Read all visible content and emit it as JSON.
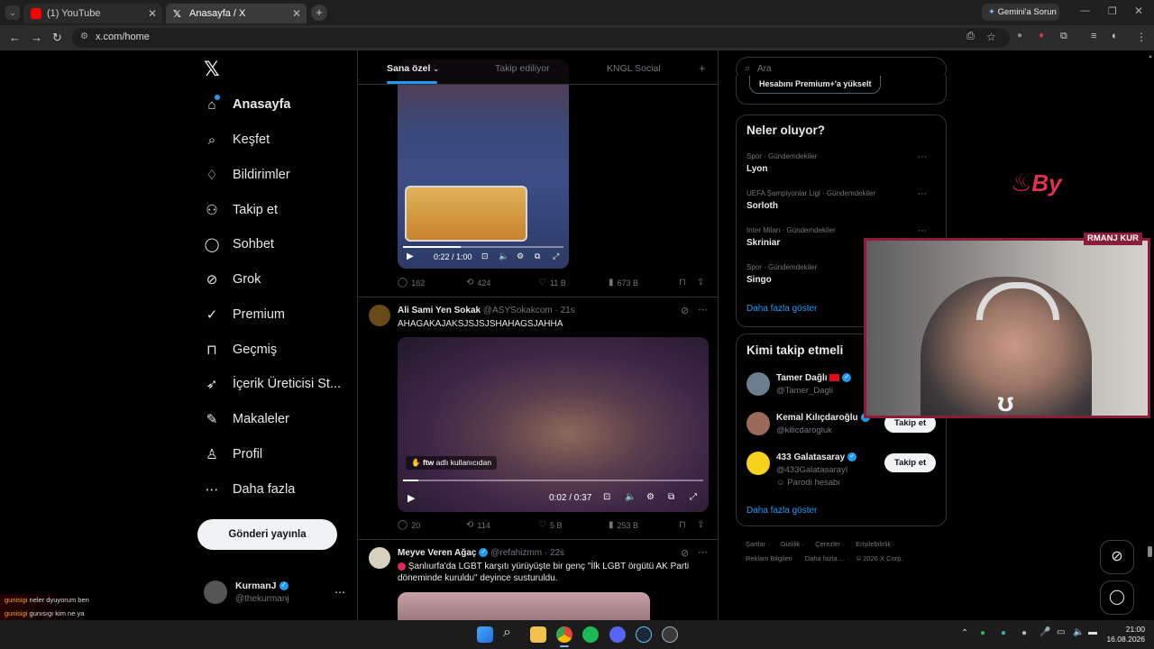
{
  "browser": {
    "tabs": [
      {
        "title": "(1) YouTube"
      },
      {
        "title": "Anasayfa / X"
      }
    ],
    "url": "x.com/home",
    "gemini_label": "Gemini'a Sorun"
  },
  "nav": {
    "items": [
      {
        "label": "Anasayfa",
        "icon": "home-icon"
      },
      {
        "label": "Keşfet",
        "icon": "search-icon"
      },
      {
        "label": "Bildirimler",
        "icon": "bell-icon"
      },
      {
        "label": "Takip et",
        "icon": "add-person-icon"
      },
      {
        "label": "Sohbet",
        "icon": "chat-icon"
      },
      {
        "label": "Grok",
        "icon": "grok-icon"
      },
      {
        "label": "Premium",
        "icon": "premium-icon"
      },
      {
        "label": "Geçmiş",
        "icon": "bookmark-icon"
      },
      {
        "label": "İçerik Üreticisi St...",
        "icon": "rocket-icon"
      },
      {
        "label": "Makaleler",
        "icon": "article-icon"
      },
      {
        "label": "Profil",
        "icon": "person-icon"
      },
      {
        "label": "Daha fazla",
        "icon": "more-circle-icon"
      }
    ],
    "post_button": "Gönderi yayınla",
    "profile": {
      "name": "KurmanJ",
      "handle": "@thekurmanj"
    }
  },
  "feed": {
    "tabs": [
      "Sana özel",
      "Takip ediliyor",
      "KNGL Social"
    ],
    "tweet1": {
      "video_time": "0:22 / 1:00",
      "replies": "162",
      "retweets": "424",
      "likes": "11 B",
      "views": "673 B"
    },
    "tweet2": {
      "name": "Ali Sami Yen Sokak",
      "handle": "@ASYSokakcom",
      "time": "· 21s",
      "text": "AHAGAKAJAKSJSJSJSHAHAGSJAHHA",
      "video_caption_user": "ftw",
      "video_caption_rest": "adlı kullanıcıdan",
      "video_time": "0:02 / 0:37",
      "replies": "20",
      "retweets": "114",
      "likes": "5 B",
      "views": "253 B"
    },
    "tweet3": {
      "name": "Meyve Veren Ağaç",
      "handle": "@refahizmm",
      "time": "· 22s",
      "text": "Şanlıurfa'da LGBT karşıtı yürüyüşte bir genç \"İlk LGBT örgütü AK Parti döneminde kuruldu\" deyince susturuldu."
    }
  },
  "right": {
    "search_placeholder": "Ara",
    "premium_btn": "Hesabını Premium+'a yükselt",
    "trends_title": "Neler oluyor?",
    "trends": [
      {
        "meta": "Spor · Gündemdekiler",
        "name": "Lyon"
      },
      {
        "meta": "UEFA Şampiyonlar Ligi · Gündemdekiler",
        "name": "Sorloth"
      },
      {
        "meta": "Inter Milan · Gündemdekiler",
        "name": "Skriniar"
      },
      {
        "meta": "Spor · Gündemdekiler",
        "name": "Singo"
      }
    ],
    "show_more": "Daha fazla göster",
    "who_title": "Kimi takip etmeli",
    "who": [
      {
        "name": "Tamer Dağlı",
        "handle": "@Tamer_Dagli"
      },
      {
        "name": "Kemal Kılıçdaroğlu",
        "handle": "@kilicdarogluk",
        "button": "Takip et"
      },
      {
        "name": "433 Galatasaray",
        "handle": "@433GalatasarayI",
        "note": "Parodi hesabı",
        "button": "Takip et"
      }
    ],
    "who_show_more": "Daha fazla göster",
    "footer_line1": [
      "Şartlar",
      "Gizlilik",
      "Çerezler",
      "Erişilebilirlik"
    ],
    "footer_line2": [
      "Reklam Bilgileri",
      "Daha fazla ...",
      "© 2026 X Corp."
    ]
  },
  "overlay": {
    "banner": "RMANJ  KUR",
    "chat": [
      {
        "user": "gunisigi",
        "msg": "neler dyuyorum ben"
      },
      {
        "user": "gunisigi",
        "msg": "gunısıgı kim ne ya"
      }
    ]
  },
  "taskbar": {
    "time": "21:00",
    "date": "16.08.2026"
  },
  "colors": {
    "accent": "#1d9bf0",
    "stream_frame": "#8b1d3a"
  }
}
